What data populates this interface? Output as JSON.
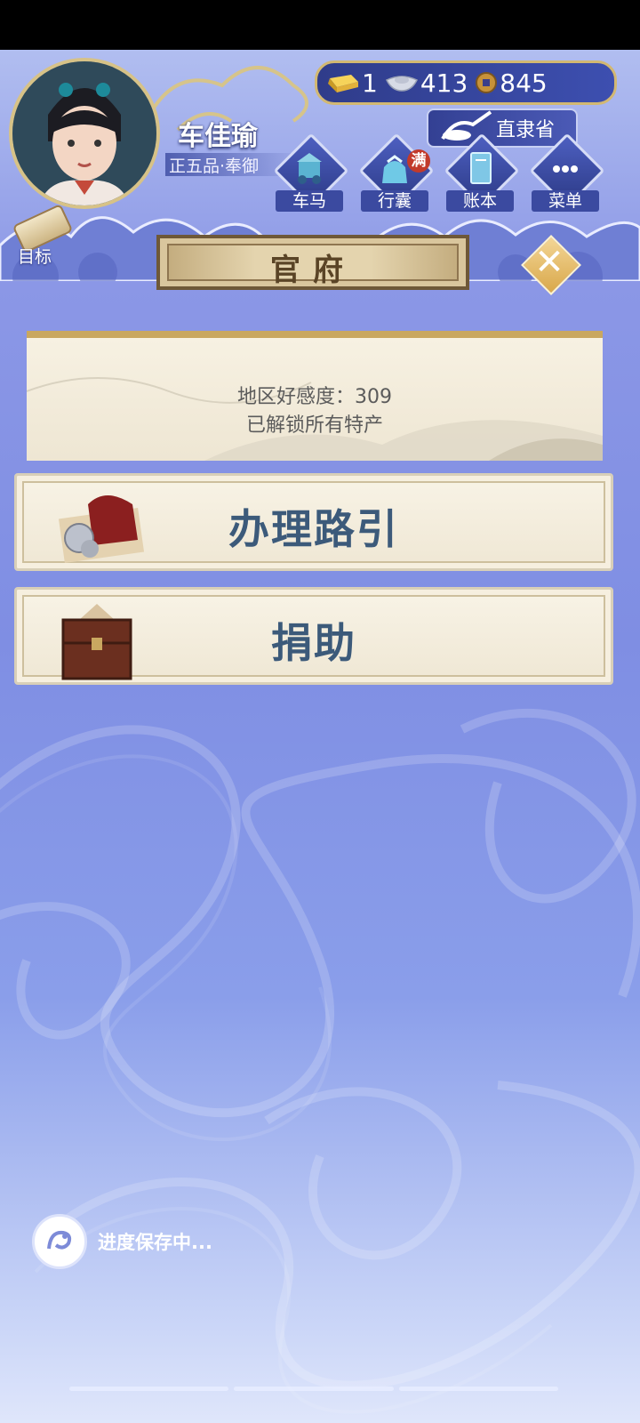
{
  "player": {
    "name": "车佳瑜",
    "rank": "正五品·奉御"
  },
  "currency": {
    "gold": "1",
    "silver": "413",
    "copper": "845"
  },
  "location": "直隶省",
  "top_menu": [
    {
      "label": "车马",
      "icon": "carriage-icon"
    },
    {
      "label": "行囊",
      "icon": "bag-icon",
      "badge": "满"
    },
    {
      "label": "账本",
      "icon": "ledger-icon"
    },
    {
      "label": "菜单",
      "icon": "more-icon"
    }
  ],
  "target_label": "目标",
  "page_title": "官府",
  "info": {
    "favor": "地区好感度：309",
    "specialty": "已解锁所有特产"
  },
  "actions": [
    {
      "label": "办理路引",
      "icon": "travel-pass-icon"
    },
    {
      "label": "捐助",
      "icon": "treasure-chest-icon"
    }
  ],
  "save_status": "进度保存中..."
}
